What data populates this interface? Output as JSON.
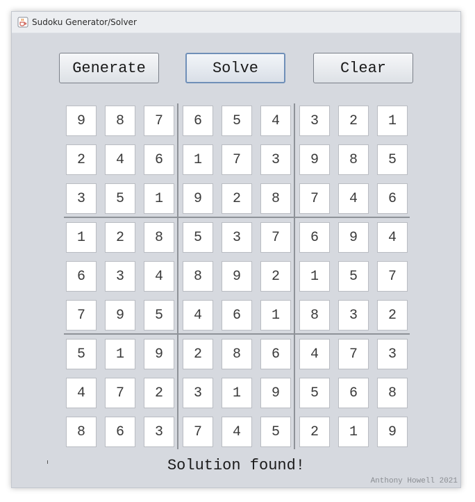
{
  "window": {
    "title": "Sudoku Generator/Solver",
    "icon": "java-cup-icon"
  },
  "toolbar": {
    "generate_label": "Generate",
    "solve_label": "Solve",
    "clear_label": "Clear"
  },
  "board": [
    [
      "9",
      "8",
      "7",
      "6",
      "5",
      "4",
      "3",
      "2",
      "1"
    ],
    [
      "2",
      "4",
      "6",
      "1",
      "7",
      "3",
      "9",
      "8",
      "5"
    ],
    [
      "3",
      "5",
      "1",
      "9",
      "2",
      "8",
      "7",
      "4",
      "6"
    ],
    [
      "1",
      "2",
      "8",
      "5",
      "3",
      "7",
      "6",
      "9",
      "4"
    ],
    [
      "6",
      "3",
      "4",
      "8",
      "9",
      "2",
      "1",
      "5",
      "7"
    ],
    [
      "7",
      "9",
      "5",
      "4",
      "6",
      "1",
      "8",
      "3",
      "2"
    ],
    [
      "5",
      "1",
      "9",
      "2",
      "8",
      "6",
      "4",
      "7",
      "3"
    ],
    [
      "4",
      "7",
      "2",
      "3",
      "1",
      "9",
      "5",
      "6",
      "8"
    ],
    [
      "8",
      "6",
      "3",
      "7",
      "4",
      "5",
      "2",
      "1",
      "9"
    ]
  ],
  "status": "Solution found!",
  "credit": "Anthony Howell 2021"
}
